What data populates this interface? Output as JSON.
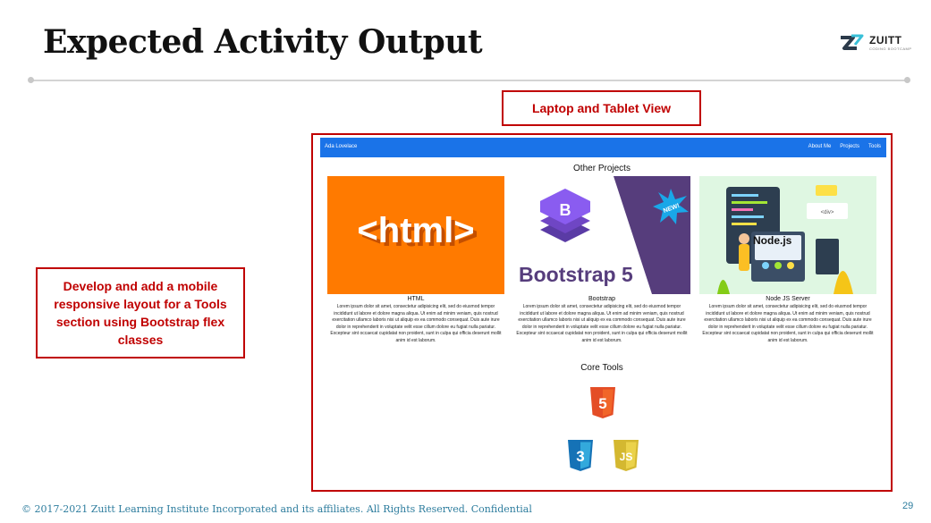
{
  "slide": {
    "title": "Expected Activity Output",
    "footer": "© 2017-2021 Zuitt Learning Institute Incorporated and its affiliates. All Rights Reserved. Confidential",
    "page_number": "29"
  },
  "logo": {
    "text": "ZUITT",
    "subtext": "CODING BOOTCAMP"
  },
  "callouts": {
    "top": "Laptop and Tablet View",
    "left": "Develop and add a mobile responsive layout for a Tools section using Bootstrap flex classes"
  },
  "preview": {
    "navbar": {
      "brand": "Ada Lovelace",
      "links": [
        "About Me",
        "Projects",
        "Tools"
      ]
    },
    "other_projects_title": "Other Projects",
    "cards": [
      {
        "title": "HTML",
        "image_text": "<html>",
        "text": "Lorem ipsum dolor sit amet, consectetur adipisicing elit, sed do eiusmod tempor incididunt ut labore et dolore magna aliqua. Ut enim ad minim veniam, quis nostrud exercitation ullamco laboris nisi ut aliquip ex ea commodo consequat. Duis aute irure dolor in reprehenderit in voluptate velit esse cillum dolore eu fugiat nulla pariatur. Excepteur sint occaecat cupidatat non proident, sunt in culpa qui officia deserunt mollit anim id est laborum."
      },
      {
        "title": "Bootstrap",
        "image_text": "Bootstrap 5",
        "badge": "NEW!",
        "text": "Lorem ipsum dolor sit amet, consectetur adipisicing elit, sed do eiusmod tempor incididunt ut labore et dolore magna aliqua. Ut enim ad minim veniam, quis nostrud exercitation ullamco laboris nisi ut aliquip ex ea commodo consequat. Duis aute irure dolor in reprehenderit in voluptate velit esse cillum dolore eu fugiat nulla pariatur. Excepteur sint occaecat cupidatat non proident, sunt in culpa qui officia deserunt mollit anim id est laborum."
      },
      {
        "title": "Node JS Server",
        "image_text": "Node.js",
        "text": "Lorem ipsum dolor sit amet, consectetur adipisicing elit, sed do eiusmod tempor incididunt ut labore et dolore magna aliqua. Ut enim ad minim veniam, quis nostrud exercitation ullamco laboris nisi ut aliquip ex ea commodo consequat. Duis aute irure dolor in reprehenderit in voluptate velit esse cillum dolore eu fugiat nulla pariatur. Excepteur sint occaecat cupidatat non proident, sunt in culpa qui officia deserunt mollit anim id est laborum."
      }
    ],
    "core_tools_title": "Core Tools",
    "tools": [
      {
        "label": "5",
        "color": "#e44d26",
        "icon": "html5-icon"
      },
      {
        "label": "3",
        "color": "#1572b6",
        "icon": "css3-icon"
      },
      {
        "label": "JS",
        "color": "#d4b830",
        "icon": "js-icon"
      }
    ]
  },
  "colors": {
    "accent_red": "#c00000",
    "navbar_blue": "#1a73e8",
    "footer_teal": "#2e7d9e"
  }
}
